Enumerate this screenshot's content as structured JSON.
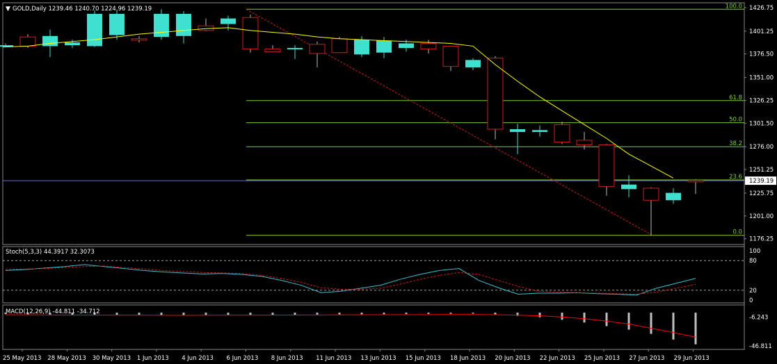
{
  "window": {
    "title_arrow": "▼",
    "symbol_header": "GOLD,Daily  1239.46 1240.70 1224.96 1239.19",
    "current_price_label": "1239.19"
  },
  "colors": {
    "background": "#000000",
    "bull": "#40e0d0",
    "bear": "#cc1f1f",
    "ma": "#ffff00",
    "fib": "#7fcf2f",
    "trend": "#cc1f1f",
    "stoch_main": "#40c0d0",
    "stoch_signal": "#cc1f1f",
    "macd_hist": "#c0c0c0",
    "macd_signal": "#ff0000",
    "axis_text": "#ffffff",
    "frame": "#8a8a8a"
  },
  "chart_data": [
    {
      "type": "candlestick",
      "symbol": "GOLD",
      "timeframe": "Daily",
      "header_values": {
        "open": 1239.46,
        "high": 1240.7,
        "low": 1224.96,
        "close": 1239.19
      },
      "ylim": [
        1170,
        1432
      ],
      "y_ticks": [
        "1426.75",
        "1401.25",
        "1376.50",
        "1351.00",
        "1326.25",
        "1301.50",
        "1276.00",
        "1251.25",
        "1225.75",
        "1201.00",
        "1176.25"
      ],
      "y_tick_values": [
        1426.75,
        1401.25,
        1376.5,
        1351.0,
        1326.25,
        1301.5,
        1276.0,
        1251.25,
        1225.75,
        1201.0,
        1176.25
      ],
      "x_labels": [
        "25 May 2013",
        "28 May 2013",
        "30 May 2013",
        "1 Jun 2013",
        "4 Jun 2013",
        "6 Jun 2013",
        "8 Jun 2013",
        "11 Jun 2013",
        "13 Jun 2013",
        "15 Jun 2013",
        "18 Jun 2013",
        "20 Jun 2013",
        "22 Jun 2013",
        "25 Jun 2013",
        "27 Jun 2013",
        "29 Jun 2013"
      ],
      "candles": [
        {
          "o": 1386,
          "h": 1388,
          "l": 1384,
          "c": 1386
        },
        {
          "o": 1395,
          "h": 1398,
          "l": 1383,
          "c": 1385
        },
        {
          "o": 1385,
          "h": 1403,
          "l": 1373,
          "c": 1396
        },
        {
          "o": 1386,
          "h": 1392,
          "l": 1383,
          "c": 1389
        },
        {
          "o": 1385,
          "h": 1424,
          "l": 1384,
          "c": 1420
        },
        {
          "o": 1397,
          "h": 1424,
          "l": 1392,
          "c": 1420
        },
        {
          "o": 1393,
          "h": 1396,
          "l": 1389,
          "c": 1392
        },
        {
          "o": 1395,
          "h": 1425,
          "l": 1392,
          "c": 1420
        },
        {
          "o": 1396,
          "h": 1423,
          "l": 1388,
          "c": 1420
        },
        {
          "o": 1407,
          "h": 1415,
          "l": 1401,
          "c": 1402
        },
        {
          "o": 1409,
          "h": 1418,
          "l": 1402,
          "c": 1415
        },
        {
          "o": 1416,
          "h": 1419,
          "l": 1378,
          "c": 1382
        },
        {
          "o": 1382,
          "h": 1386,
          "l": 1379,
          "c": 1379
        },
        {
          "o": 1383,
          "h": 1386,
          "l": 1371,
          "c": 1383
        },
        {
          "o": 1387,
          "h": 1390,
          "l": 1362,
          "c": 1377
        },
        {
          "o": 1393,
          "h": 1395,
          "l": 1379,
          "c": 1378
        },
        {
          "o": 1376,
          "h": 1396,
          "l": 1373,
          "c": 1392
        },
        {
          "o": 1378,
          "h": 1395,
          "l": 1372,
          "c": 1391
        },
        {
          "o": 1383,
          "h": 1392,
          "l": 1379,
          "c": 1388
        },
        {
          "o": 1388,
          "h": 1392,
          "l": 1377,
          "c": 1382
        },
        {
          "o": 1385,
          "h": 1381,
          "l": 1358,
          "c": 1363
        },
        {
          "o": 1362,
          "h": 1372,
          "l": 1359,
          "c": 1370
        },
        {
          "o": 1372,
          "h": 1374,
          "l": 1284,
          "c": 1295
        },
        {
          "o": 1292,
          "h": 1301,
          "l": 1268,
          "c": 1295
        },
        {
          "o": 1292,
          "h": 1299,
          "l": 1287,
          "c": 1294
        },
        {
          "o": 1300,
          "h": 1303,
          "l": 1279,
          "c": 1281
        },
        {
          "o": 1283,
          "h": 1292,
          "l": 1273,
          "c": 1278
        },
        {
          "o": 1278,
          "h": 1279,
          "l": 1223,
          "c": 1233
        },
        {
          "o": 1230,
          "h": 1245,
          "l": 1221,
          "c": 1235
        },
        {
          "o": 1231,
          "h": 1232,
          "l": 1180,
          "c": 1218
        },
        {
          "o": 1218,
          "h": 1231,
          "l": 1214,
          "c": 1226
        },
        {
          "o": 1239.46,
          "h": 1240.7,
          "l": 1224.96,
          "c": 1239.19
        }
      ],
      "ma_line": [
        1384,
        1385,
        1388,
        1390,
        1392,
        1395,
        1398,
        1400,
        1402,
        1404,
        1405,
        1402,
        1400,
        1398,
        1395,
        1393,
        1392,
        1391,
        1390,
        1389,
        1388,
        1385,
        1365,
        1347,
        1330,
        1315,
        1300,
        1285,
        1268,
        1255,
        1242
      ],
      "fibonacci": [
        {
          "level": "100.0",
          "price": 1425
        },
        {
          "level": "61.8",
          "price": 1326
        },
        {
          "level": "50.0",
          "price": 1302
        },
        {
          "level": "38.2",
          "price": 1276
        },
        {
          "level": "23.6",
          "price": 1240
        },
        {
          "level": "0.0",
          "price": 1180
        }
      ],
      "trendline": {
        "from_price": 1425,
        "to_price": 1180
      }
    },
    {
      "type": "line",
      "title": "Stoch(5,3,3) 44.3917 32.3073",
      "ylim": [
        0,
        100
      ],
      "y_ticks": [
        "100",
        "80",
        "20",
        "0"
      ],
      "y_tick_values": [
        100,
        80,
        20,
        0
      ],
      "levels": [
        80,
        20
      ],
      "series": [
        {
          "values": [
            60,
            62,
            65,
            68,
            72,
            68,
            64,
            60,
            57,
            55,
            53,
            54,
            52,
            48,
            40,
            30,
            15,
            18,
            24,
            30,
            42,
            52,
            60,
            64,
            40,
            25,
            12,
            14,
            14,
            15,
            13,
            12,
            10,
            24,
            34,
            44
          ]
        },
        {
          "values": [
            62,
            63,
            64,
            66,
            68,
            69,
            66,
            63,
            60,
            58,
            56,
            55,
            54,
            50,
            44,
            36,
            25,
            22,
            22,
            24,
            32,
            42,
            50,
            56,
            52,
            40,
            28,
            18,
            16,
            15,
            14,
            13,
            12,
            16,
            24,
            32
          ]
        }
      ]
    },
    {
      "type": "bar",
      "title": "MACD(12,26,9) -44.811 -34.712",
      "ylim": [
        -50,
        5
      ],
      "y_ticks": [
        "-6.243",
        "-46.811"
      ],
      "y_tick_values": [
        -6.243,
        -46.811
      ],
      "histogram": [
        -2,
        -2.5,
        -2.8,
        -3,
        -3,
        -3.2,
        -3.5,
        -3.5,
        -3.8,
        -3.6,
        -3.5,
        -3.4,
        -3.2,
        -3,
        -2.8,
        -2.6,
        -2.4,
        -2.2,
        -2,
        -1.8,
        -1.6,
        -1.4,
        -2.8,
        -4.5,
        -6.5,
        -10,
        -14,
        -19,
        -24,
        -30,
        -38,
        -44.8
      ],
      "signal": [
        -3,
        -3,
        -3.2,
        -3.3,
        -3.4,
        -3.5,
        -3.5,
        -3.6,
        -3.7,
        -3.6,
        -3.5,
        -3.5,
        -3.4,
        -3.3,
        -3.2,
        -3.1,
        -3,
        -2.9,
        -2.8,
        -2.7,
        -2.6,
        -2.6,
        -2.8,
        -3.5,
        -4.5,
        -6,
        -8.5,
        -12,
        -16,
        -22,
        -28,
        -34.7
      ]
    }
  ]
}
